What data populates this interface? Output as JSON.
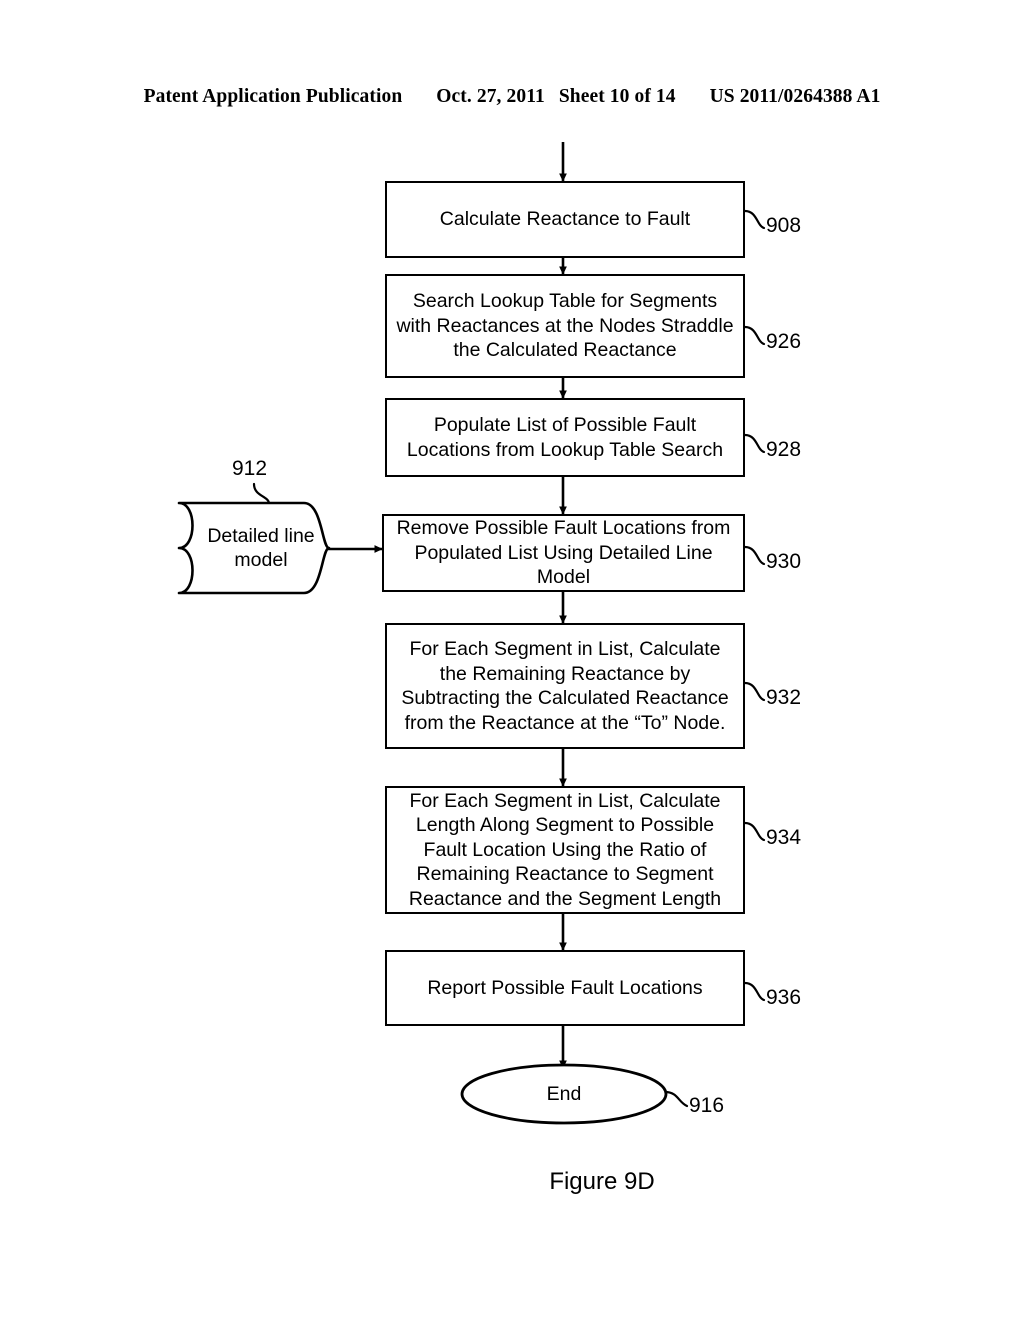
{
  "header": {
    "publication": "Patent Application Publication",
    "date": "Oct. 27, 2011",
    "sheet": "Sheet 10 of 14",
    "document_number": "US 2011/0264388 A1"
  },
  "figure": {
    "caption": "Figure 9D"
  },
  "flowchart": {
    "nodes": [
      {
        "id": "908",
        "shape": "process",
        "text": "Calculate Reactance to Fault",
        "ref": "908"
      },
      {
        "id": "926",
        "shape": "process",
        "text": "Search Lookup Table for Segments\nwith Reactances at the Nodes Straddle\nthe Calculated Reactance",
        "ref": "926"
      },
      {
        "id": "928",
        "shape": "process",
        "text": "Populate List of Possible Fault\nLocations from Lookup Table Search",
        "ref": "928"
      },
      {
        "id": "912",
        "shape": "tape",
        "text": "Detailed line\nmodel",
        "ref": "912"
      },
      {
        "id": "930",
        "shape": "process",
        "text": "Remove Possible Fault Locations from\nPopulated List Using Detailed Line\nModel",
        "ref": "930"
      },
      {
        "id": "932",
        "shape": "process",
        "text": "For Each Segment in List, Calculate\nthe Remaining Reactance by\nSubtracting the Calculated Reactance\nfrom the Reactance at the “To” Node.",
        "ref": "932"
      },
      {
        "id": "934",
        "shape": "process",
        "text": "For Each Segment in List, Calculate\nLength Along Segment to Possible\nFault Location Using the Ratio of\nRemaining Reactance to Segment\nReactance and the Segment Length",
        "ref": "934"
      },
      {
        "id": "936",
        "shape": "process",
        "text": "Report Possible Fault Locations",
        "ref": "936"
      },
      {
        "id": "916",
        "shape": "terminator",
        "text": "End",
        "ref": "916"
      }
    ]
  },
  "colors": {
    "ink": "#000000",
    "paper": "#ffffff"
  }
}
